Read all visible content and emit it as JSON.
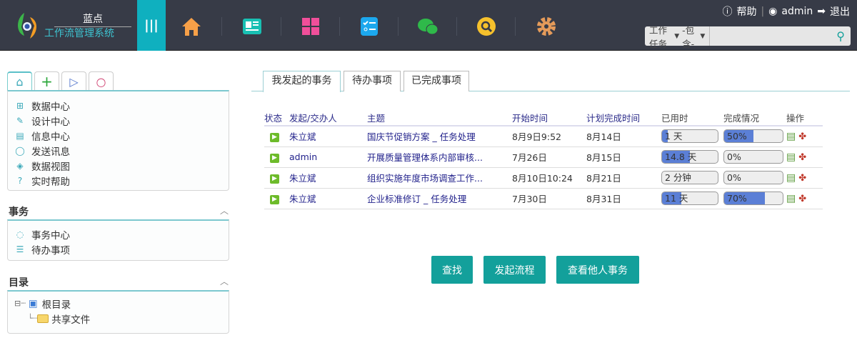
{
  "header": {
    "brand": "蓝点",
    "subtitle": "工作流管理系统",
    "help": "帮助",
    "user": "admin",
    "logout": "退出",
    "nav_icons": [
      "home-icon",
      "news-icon",
      "apps-icon",
      "checklist-icon",
      "chat-icon",
      "search-icon",
      "gear-icon"
    ],
    "search": {
      "type": "工作任务",
      "op": "-包含-",
      "value": ""
    }
  },
  "sidebar": {
    "tabs": [
      "home-icon",
      "plus-icon",
      "play-icon",
      "search-icon"
    ],
    "menu": [
      {
        "label": "数据中心",
        "icon": "grid-icon"
      },
      {
        "label": "设计中心",
        "icon": "palette-icon"
      },
      {
        "label": "信息中心",
        "icon": "doc-icon"
      },
      {
        "label": "发送讯息",
        "icon": "message-icon"
      },
      {
        "label": "数据视图",
        "icon": "layers-icon"
      },
      {
        "label": "实时帮助",
        "icon": "help-icon"
      }
    ],
    "affairs": {
      "title": "事务",
      "items": [
        "事务中心",
        "待办事项"
      ]
    },
    "dir": {
      "title": "目录",
      "root": "根目录",
      "child": "共享文件"
    }
  },
  "main": {
    "tabs": [
      "我发起的事务",
      "待办事项",
      "已完成事项"
    ],
    "columns": [
      "状态",
      "发起/交办人",
      "主题",
      "开始时间",
      "计划完成时间",
      "已用时",
      "完成情况",
      "操作"
    ],
    "rows": [
      {
        "person": "朱立斌",
        "subject": "国庆节促销方案 _ 任务处理",
        "start": "8月9日9:52",
        "due": "8月14日",
        "used": "1 天",
        "used_pct": 10,
        "done": "50%",
        "done_pct": 50
      },
      {
        "person": "admin",
        "subject": "开展质量管理体系内部审核...",
        "start": "7月26日",
        "due": "8月15日",
        "used": "14.8 天",
        "used_pct": 50,
        "done": "0%",
        "done_pct": 0
      },
      {
        "person": "朱立斌",
        "subject": "组织实施年度市场调查工作...",
        "start": "8月10日10:24",
        "due": "8月21日",
        "used": "2 分钟",
        "used_pct": 0,
        "done": "0%",
        "done_pct": 0
      },
      {
        "person": "朱立斌",
        "subject": "企业标准修订 _ 任务处理",
        "start": "7月30日",
        "due": "8月31日",
        "used": "11 天",
        "used_pct": 35,
        "done": "70%",
        "done_pct": 70
      }
    ],
    "buttons": [
      "查找",
      "发起流程",
      "查看他人事务"
    ]
  },
  "colors": {
    "accent": "#13a09b",
    "header": "#373b47",
    "bar": "#5b7fd6"
  }
}
